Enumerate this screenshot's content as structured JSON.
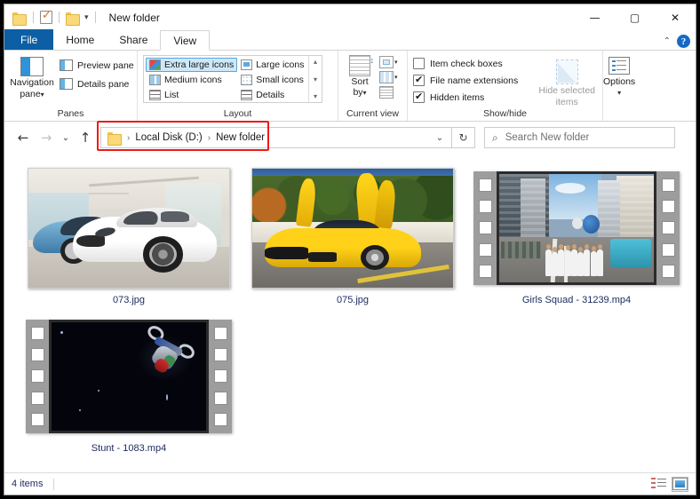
{
  "window": {
    "title": "New folder",
    "quick_access": {
      "folder_icon": "folder-icon",
      "properties_icon": "properties-checkmark-icon",
      "new_folder_icon": "new-folder-icon",
      "customize_caret": "▾"
    },
    "controls": {
      "minimize": "—",
      "maximize": "▢",
      "close": "✕"
    }
  },
  "tabs": [
    {
      "label": "File",
      "active": false,
      "style": "file"
    },
    {
      "label": "Home",
      "active": false
    },
    {
      "label": "Share",
      "active": false
    },
    {
      "label": "View",
      "active": true
    }
  ],
  "ribbon_right": {
    "collapse_caret": "⌃",
    "help_label": "?"
  },
  "ribbon": {
    "groups": [
      {
        "title": "Panes",
        "navigation_pane": {
          "line1": "Navigation",
          "line2": "pane",
          "caret": "▾"
        },
        "items": [
          {
            "label": "Preview pane"
          },
          {
            "label": "Details pane"
          }
        ]
      },
      {
        "title": "Layout",
        "options": [
          {
            "label": "Extra large icons",
            "selected": true
          },
          {
            "label": "Large icons",
            "selected": false
          },
          {
            "label": "Medium icons",
            "selected": false
          },
          {
            "label": "Small icons",
            "selected": false
          },
          {
            "label": "List",
            "selected": false
          },
          {
            "label": "Details",
            "selected": false
          }
        ],
        "scroll": {
          "up": "▴",
          "down": "▾",
          "more": "▾"
        }
      },
      {
        "title": "Current view",
        "sort_by": {
          "line1": "Sort",
          "line2": "by",
          "caret": "▾"
        },
        "mini_buttons": [
          "group-by-icon",
          "add-columns-icon",
          "size-all-columns-icon"
        ]
      },
      {
        "title": "Show/hide",
        "checkboxes": [
          {
            "label": "Item check boxes",
            "checked": false
          },
          {
            "label": "File name extensions",
            "checked": true
          },
          {
            "label": "Hidden items",
            "checked": true
          }
        ],
        "hide_selected": {
          "line1": "Hide selected",
          "line2": "items",
          "disabled": true
        }
      },
      {
        "title": "",
        "options_button": {
          "label": "Options",
          "caret": "▾"
        }
      }
    ]
  },
  "address_bar": {
    "back": "←",
    "forward": "→",
    "recent": "⌄",
    "up": "↑",
    "breadcrumbs": [
      "Local Disk (D:)",
      "New folder"
    ],
    "separator": "›",
    "dropdown_caret": "⌄",
    "refresh": "↻",
    "highlighted": true,
    "highlight_color": "#ef1b13"
  },
  "search": {
    "icon": "search-icon",
    "placeholder": "Search New folder"
  },
  "files": [
    {
      "name": "073.jpg",
      "type": "image",
      "thumb": "white-sports-car-showroom"
    },
    {
      "name": "075.jpg",
      "type": "image",
      "thumb": "yellow-lamborghini-doors-up"
    },
    {
      "name": "Girls Squad - 31239.mp4",
      "type": "video",
      "thumb": "parade-street-marchers"
    },
    {
      "name": "Stunt - 1083.mp4",
      "type": "video",
      "thumb": "motorcycle-stunt-night"
    }
  ],
  "status_bar": {
    "count": "4 items",
    "view_buttons": [
      {
        "name": "details-view-button",
        "active": false
      },
      {
        "name": "large-icons-view-button",
        "active": true
      }
    ]
  }
}
